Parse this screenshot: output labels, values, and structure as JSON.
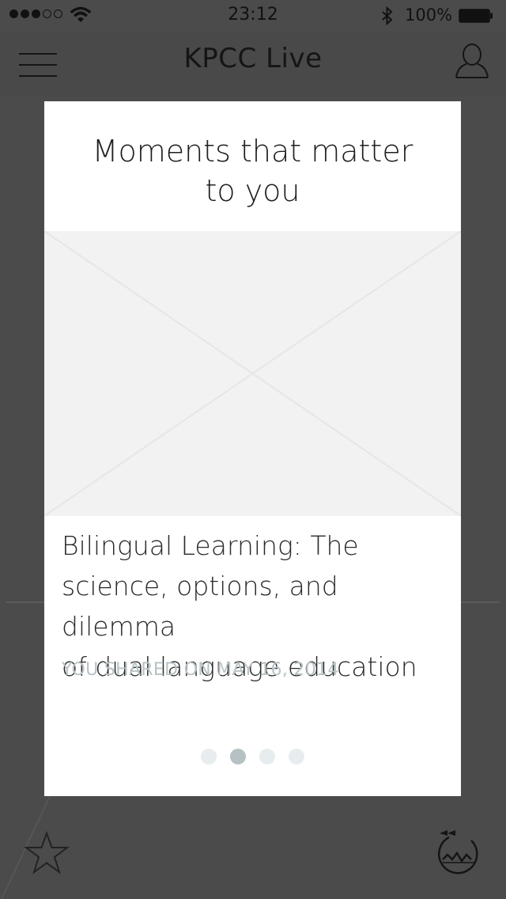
{
  "status_bar": {
    "time": "23:12",
    "battery": "100%",
    "signal_dots_filled": 3,
    "signal_dots_total": 5
  },
  "nav": {
    "title": "KPCC Live"
  },
  "card": {
    "heading_line1": "Moments that matter",
    "heading_line2": "to you",
    "story_line1": "Bilingual Learning: The",
    "story_line2": "science, options, and dilemma",
    "story_line3": "of dual language education",
    "meta": "YOU SHARED ON MAY 16, 2014",
    "pager": {
      "total": 4,
      "active_index": 1
    }
  },
  "icons": {
    "menu": "hamburger-menu-icon",
    "profile": "user-profile-icon",
    "star": "star-icon",
    "rewind": "rewind-icon"
  },
  "colors": {
    "overlay": "#4a4b4a",
    "card": "#ffffff",
    "placeholder": "#f2f2f2",
    "meta_text": "#b9c3c6",
    "dot_inactive": "#e7edef",
    "dot_active": "#b6c1c4"
  }
}
